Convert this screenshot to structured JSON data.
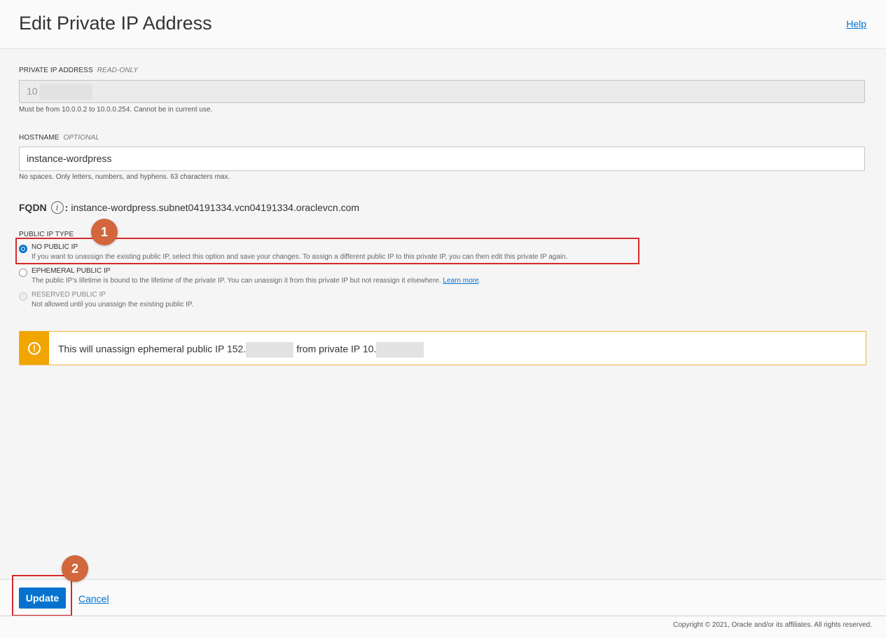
{
  "header": {
    "title": "Edit Private IP Address",
    "help_label": "Help"
  },
  "private_ip": {
    "label": "PRIVATE IP ADDRESS",
    "tag": "READ-ONLY",
    "value": "10",
    "hint": "Must be from 10.0.0.2 to 10.0.0.254. Cannot be in current use."
  },
  "hostname": {
    "label": "HOSTNAME",
    "tag": "OPTIONAL",
    "value": "instance-wordpress",
    "hint": "No spaces. Only letters, numbers, and hyphens. 63 characters max."
  },
  "fqdn": {
    "label": "FQDN",
    "info_icon": "info-icon",
    "value": "instance-wordpress.subnet04191334.vcn04191334.oraclevcn.com"
  },
  "public_ip_type": {
    "label": "PUBLIC IP TYPE",
    "options": [
      {
        "title": "NO PUBLIC IP",
        "description": "If you want to unassign the existing public IP, select this option and save your changes. To assign a different public IP to this private IP, you can then edit this private IP again.",
        "checked": true
      },
      {
        "title": "EPHEMERAL PUBLIC IP",
        "description": "The public IP's lifetime is bound to the lifetime of the private IP. You can unassign it from this private IP but not reassign it elsewhere.",
        "link": "Learn more",
        "checked": false
      },
      {
        "title": "RESERVED PUBLIC IP",
        "description": "Not allowed until you unassign the existing public IP.",
        "checked": false,
        "disabled": true
      }
    ]
  },
  "warning": {
    "icon": "warning-icon",
    "text_before": "This will unassign ephemeral public IP 152.",
    "text_middle": "from private IP 10."
  },
  "annotations": [
    "1",
    "2"
  ],
  "footer": {
    "update_label": "Update",
    "cancel_label": "Cancel",
    "copyright": "Copyright © 2021, Oracle and/or its affiliates. All rights reserved."
  },
  "colors": {
    "accent": "#0572ce",
    "warning": "#f0a500",
    "annotation": "#d2663c",
    "highlight": "#d72a2a"
  }
}
